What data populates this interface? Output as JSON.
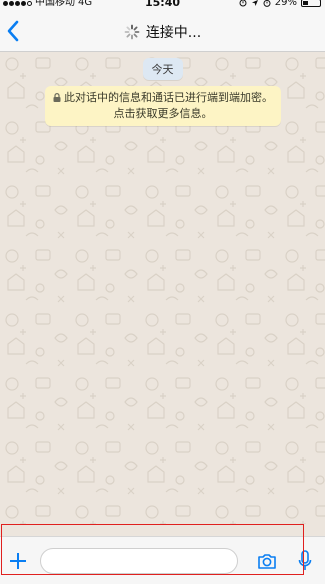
{
  "status_bar": {
    "carrier": "中国移动",
    "network": "4G",
    "time": "15:40",
    "battery": "29%",
    "battery_level": 0.29
  },
  "nav": {
    "title": "连接中..."
  },
  "chat": {
    "date_label": "今天",
    "encryption_notice": "此对话中的信息和通话已进行端到端加密。点击获取更多信息。"
  },
  "input_bar": {
    "message_value": "",
    "message_placeholder": ""
  },
  "colors": {
    "accent": "#0a7ef2",
    "wallpaper": "#ece5dd",
    "notice_bg": "#fdf4c5",
    "date_bg": "#dde8f3",
    "highlight": "#e0201e"
  },
  "icons": [
    "signal-dots-icon",
    "location-arrow-icon",
    "alarm-icon",
    "battery-icon",
    "back-chevron-icon",
    "loading-spinner-icon",
    "lock-icon",
    "plus-icon",
    "camera-icon",
    "microphone-icon"
  ]
}
